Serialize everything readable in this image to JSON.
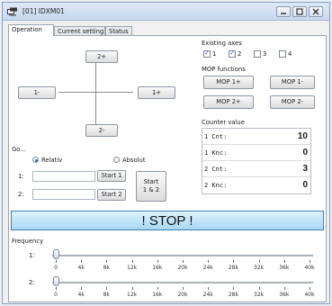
{
  "window": {
    "title": "[01] IDXM01"
  },
  "tabs": [
    "Operation",
    "Current setting",
    "Status"
  ],
  "jog": {
    "up": "2+",
    "left": "1-",
    "right": "1+",
    "down": "2-"
  },
  "axes": {
    "title": "Existing axes",
    "items": [
      {
        "label": "1",
        "checked": true
      },
      {
        "label": "2",
        "checked": true
      },
      {
        "label": "3",
        "checked": false
      },
      {
        "label": "4",
        "checked": false
      }
    ]
  },
  "mop": {
    "title": "MOP functions",
    "btn1p": "MOP 1+",
    "btn1m": "MOP 1-",
    "btn2p": "MOP 2+",
    "btn2m": "MOP 2-"
  },
  "counter": {
    "title": "Counter value",
    "rows": [
      {
        "key": "1 Cnt:",
        "value": "10"
      },
      {
        "key": "1 Knc:",
        "value": "0"
      },
      {
        "key": "2 Cnt:",
        "value": "3"
      },
      {
        "key": "2 Knc:",
        "value": "0"
      }
    ]
  },
  "go": {
    "title": "Go...",
    "relative": "Relativ",
    "absolute": "Absolut",
    "mode_selected": "relative",
    "row1_label": "1:",
    "row2_label": "2:",
    "start1": "Start 1",
    "start2": "Start 2",
    "start12_line1": "Start",
    "start12_line2": "1 & 2",
    "input1_value": "",
    "input2_value": ""
  },
  "stop_label": "! STOP !",
  "frequency": {
    "title": "Frequency",
    "slider1_label": "1:",
    "slider2_label": "2:",
    "slider1_value": 0,
    "slider2_value": 0,
    "ticks": [
      "0",
      "4k",
      "8k",
      "12k",
      "16k",
      "20k",
      "24k",
      "28k",
      "32k",
      "36k",
      "40k"
    ]
  }
}
